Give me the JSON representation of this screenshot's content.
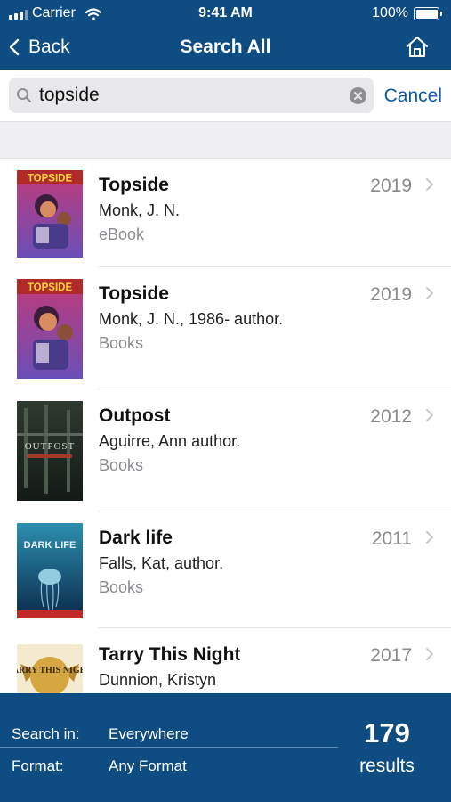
{
  "status_bar": {
    "carrier": "Carrier",
    "time": "9:41 AM",
    "battery": "100%"
  },
  "nav": {
    "back_label": "Back",
    "title": "Search All",
    "home_icon": "home-icon"
  },
  "search": {
    "query": "topside",
    "placeholder": "",
    "cancel_label": "Cancel"
  },
  "results": [
    {
      "title": "Topside",
      "author": "Monk, J. N.",
      "format": "eBook",
      "year": "2019",
      "cover_text": "TOPSIDE"
    },
    {
      "title": "Topside",
      "author": "Monk, J. N., 1986- author.",
      "format": "Books",
      "year": "2019",
      "cover_text": "TOPSIDE"
    },
    {
      "title": "Outpost",
      "author": "Aguirre, Ann author.",
      "format": "Books",
      "year": "2012",
      "cover_text": "OUTPOST"
    },
    {
      "title": "Dark life",
      "author": "Falls, Kat, author.",
      "format": "Books",
      "year": "2011",
      "cover_text": "DARK LIFE"
    },
    {
      "title": "Tarry This Night",
      "author": "Dunnion, Kristyn",
      "format": "",
      "year": "2017",
      "cover_text": "TARRY THIS NIGHT"
    }
  ],
  "filters": {
    "search_in": {
      "label": "Search in:",
      "value": "Everywhere"
    },
    "format": {
      "label": "Format:",
      "value": "Any Format"
    }
  },
  "summary": {
    "count": "179",
    "label": "results"
  },
  "colors": {
    "brand": "#0f4c81",
    "link": "#0f5aa0",
    "muted": "#8a8a8e",
    "band": "#efeff4"
  }
}
